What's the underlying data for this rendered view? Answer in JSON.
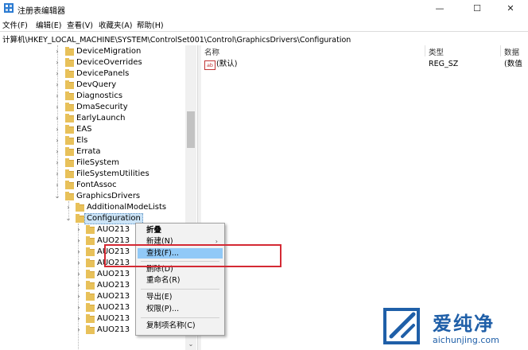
{
  "window": {
    "title": "注册表编辑器",
    "minimize_glyph": "—",
    "maximize_glyph": "☐",
    "close_glyph": "✕"
  },
  "menu": [
    "文件(F)",
    "编辑(E)",
    "查看(V)",
    "收藏夹(A)",
    "帮助(H)"
  ],
  "address": "计算机\\HKEY_LOCAL_MACHINE\\SYSTEM\\ControlSet001\\Control\\GraphicsDrivers\\Configuration",
  "tree": {
    "items": [
      {
        "label": "DeviceMigration",
        "expander": "›"
      },
      {
        "label": "DeviceOverrides",
        "expander": "›"
      },
      {
        "label": "DevicePanels",
        "expander": "›"
      },
      {
        "label": "DevQuery",
        "expander": "›"
      },
      {
        "label": "Diagnostics",
        "expander": "›"
      },
      {
        "label": "DmaSecurity",
        "expander": "›"
      },
      {
        "label": "EarlyLaunch",
        "expander": "›"
      },
      {
        "label": "EAS",
        "expander": "›"
      },
      {
        "label": "Els",
        "expander": "›"
      },
      {
        "label": "Errata",
        "expander": "›"
      },
      {
        "label": "FileSystem",
        "expander": "›"
      },
      {
        "label": "FileSystemUtilities",
        "expander": "›"
      },
      {
        "label": "FontAssoc",
        "expander": "›"
      },
      {
        "label": "GraphicsDrivers",
        "expander": "⌄"
      },
      {
        "label": "AdditionalModeLists",
        "expander": "›"
      },
      {
        "label": "Configuration",
        "expander": "⌄"
      },
      {
        "label": "AUO213",
        "expander": "›"
      },
      {
        "label": "AUO213",
        "expander": "›"
      },
      {
        "label": "AUO213",
        "expander": "›"
      },
      {
        "label": "AUO213",
        "expander": "›"
      },
      {
        "label": "AUO213",
        "expander": "›"
      },
      {
        "label": "AUO213",
        "expander": "›"
      },
      {
        "label": "AUO213",
        "expander": "›"
      },
      {
        "label": "AUO213",
        "expander": "›"
      },
      {
        "label": "AUO213",
        "expander": "›"
      },
      {
        "label": "AUO213",
        "expander": "›"
      }
    ]
  },
  "list": {
    "columns": [
      "名称",
      "类型",
      "数据"
    ],
    "rows": [
      {
        "icon": "ab",
        "name": "(默认)",
        "type": "REG_SZ",
        "data": "(数值"
      }
    ]
  },
  "context_menu": {
    "items": [
      {
        "label": "折叠",
        "bold": true
      },
      {
        "label": "新建(N)",
        "submenu": "›"
      },
      {
        "label": "查找(F)...",
        "highlighted": true
      },
      {
        "label": "删除(D)"
      },
      {
        "label": "重命名(R)"
      },
      {
        "label": "导出(E)"
      },
      {
        "label": "权限(P)..."
      },
      {
        "label": "复制项名称(C)"
      }
    ]
  },
  "colors": {
    "highlight": "#91c9f7",
    "selection": "#cce4f7",
    "annotation": "#d42a34",
    "folder": "#e8c15a",
    "watermark": "#1f5fa8"
  },
  "watermark": {
    "title": "爱纯净",
    "url": "aichunjing.com"
  },
  "scrollbar": {
    "down_glyph": "⌄"
  }
}
